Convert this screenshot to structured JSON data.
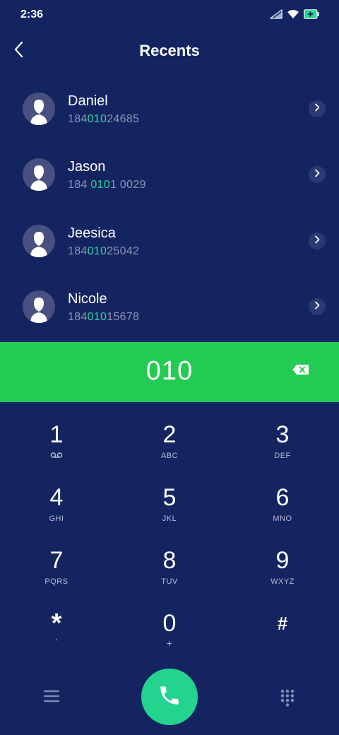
{
  "status_bar": {
    "time": "2:36",
    "icons": [
      "signal-icon",
      "wifi-icon",
      "battery-charging-icon"
    ]
  },
  "header": {
    "title": "Recents",
    "back_icon": "chevron-left-icon"
  },
  "recents": [
    {
      "name": "Daniel",
      "number_prefix": "184",
      "number_match": "010",
      "number_suffix": "24685"
    },
    {
      "name": "Jason",
      "number_prefix": "184 ",
      "number_match": "010",
      "number_suffix": "1 0029"
    },
    {
      "name": "Jeesica",
      "number_prefix": "184",
      "number_match": "010",
      "number_suffix": "25042"
    },
    {
      "name": "Nicole",
      "number_prefix": "184",
      "number_match": "010",
      "number_suffix": "15678"
    }
  ],
  "dialer": {
    "value": "010",
    "backspace_icon": "backspace-icon"
  },
  "keypad": [
    {
      "digit": "1",
      "sub": "",
      "sub_icon": "voicemail-icon"
    },
    {
      "digit": "2",
      "sub": "ABC"
    },
    {
      "digit": "3",
      "sub": "DEF"
    },
    {
      "digit": "4",
      "sub": "GHI"
    },
    {
      "digit": "5",
      "sub": "JKL"
    },
    {
      "digit": "6",
      "sub": "MNO"
    },
    {
      "digit": "7",
      "sub": "PQRS"
    },
    {
      "digit": "8",
      "sub": "TUV"
    },
    {
      "digit": "9",
      "sub": "WXYZ"
    },
    {
      "digit": "*",
      "sub": ","
    },
    {
      "digit": "0",
      "sub": "+"
    },
    {
      "digit": "#",
      "sub": ""
    }
  ],
  "bottom_bar": {
    "menu_icon": "menu-icon",
    "call_icon": "phone-icon",
    "keypad_icon": "dialpad-icon"
  },
  "colors": {
    "background": "#142461",
    "dial_bar": "#22cb52",
    "call_button": "#22d48e",
    "number_highlight": "#2ed59e",
    "number_text": "#8e95b5"
  }
}
